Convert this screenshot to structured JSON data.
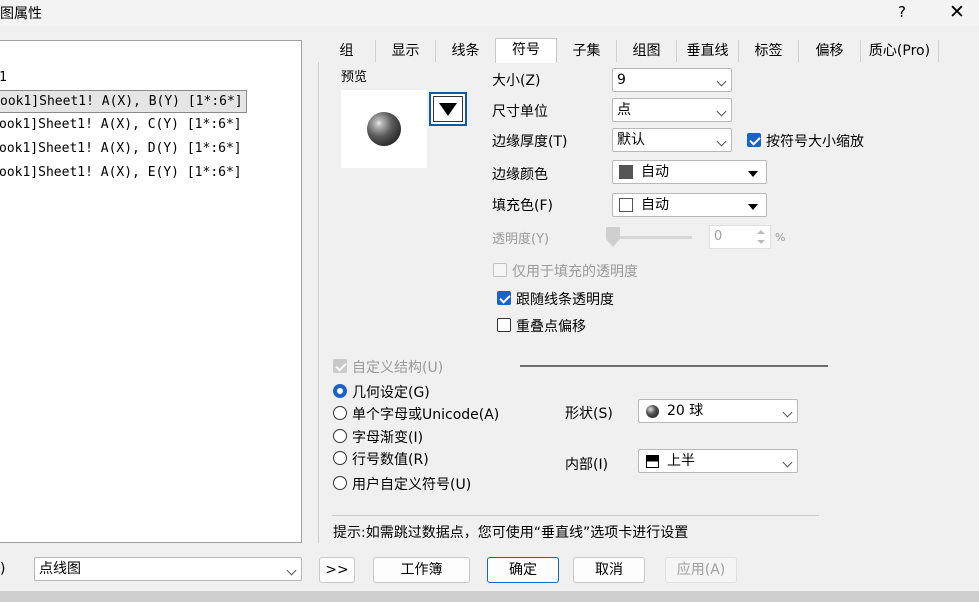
{
  "window": {
    "title": "图属性",
    "help": "?",
    "close": "✕"
  },
  "plot_list": {
    "header": "1",
    "items": [
      "ook1]Sheet1! A(X), B(Y) [1*:6*]",
      "ook1]Sheet1! A(X), C(Y) [1*:6*]",
      "ook1]Sheet1! A(X), D(Y) [1*:6*]",
      "ook1]Sheet1! A(X), E(Y) [1*:6*]"
    ]
  },
  "tabs": [
    "组",
    "显示",
    "线条",
    "符号",
    "子集",
    "组图",
    "垂直线",
    "标签",
    "偏移",
    "质心(Pro)"
  ],
  "symbol": {
    "preview_label": "预览",
    "size_label": "大小(Z)",
    "size_value": "9",
    "unit_label": "尺寸单位",
    "unit_value": "点",
    "edge_label": "边缘厚度(T)",
    "edge_value": "默认",
    "scale_label": "按符号大小缩放",
    "edge_color_label": "边缘颜色",
    "edge_color_value": "自动",
    "edge_color": "#555555",
    "fill_label": "填充色(F)",
    "fill_value": "自动",
    "fill_color": "#ffffff",
    "transparency_label": "透明度(Y)",
    "transparency_value": "0",
    "transparency_unit": "%",
    "fill_only_label": "仅用于填充的透明度",
    "follow_line_label": "跟随线条透明度",
    "overlap_label": "重叠点偏移",
    "custom_label": "自定义结构(U)",
    "radios": [
      "几何设定(G)",
      "单个字母或Unicode(A)",
      "字母渐变(I)",
      "行号数值(R)",
      "用户自定义符号(U)"
    ],
    "shape_label": "形状(S)",
    "shape_value": "20 球",
    "interior_label": "内部(I)",
    "interior_value": "上半",
    "hint": "提示:如需跳过数据点，您可使用“垂直线”选项卡进行设置"
  },
  "footer": {
    "left_fragment": ")",
    "plot_type": "点线图",
    "expand": ">>",
    "workbook": "工作簿",
    "ok": "确定",
    "cancel": "取消",
    "apply": "应用(A)"
  }
}
